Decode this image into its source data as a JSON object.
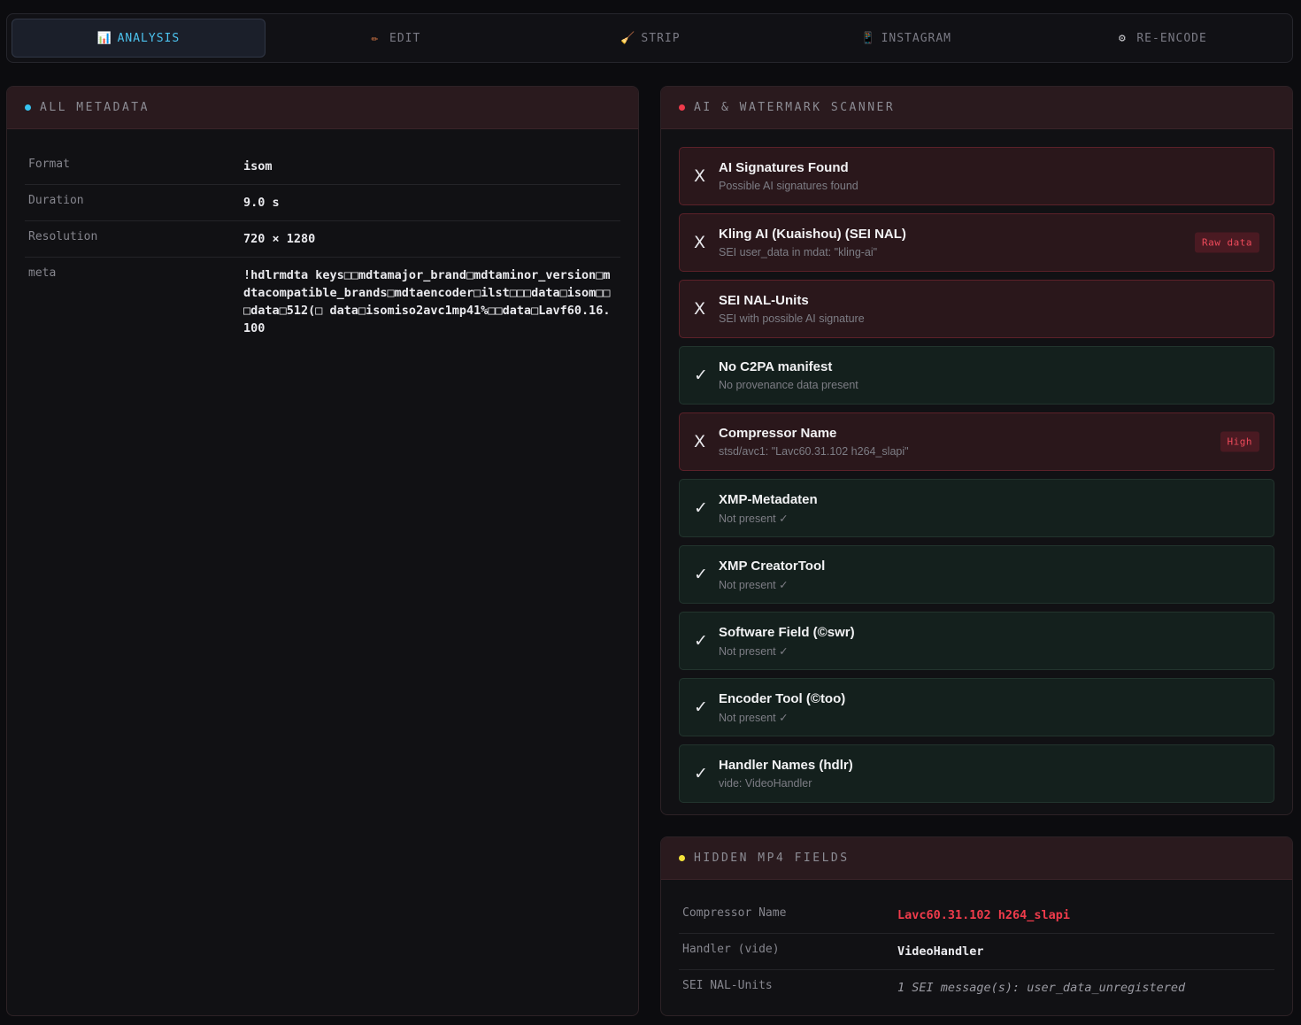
{
  "tabs": [
    {
      "icon": "📊",
      "label": "ANALYSIS",
      "active": true
    },
    {
      "icon": "✏",
      "label": "EDIT"
    },
    {
      "icon": "🧹",
      "label": "STRIP"
    },
    {
      "icon": "📱",
      "label": "INSTAGRAM"
    },
    {
      "icon": "⚙",
      "label": "RE-ENCODE"
    }
  ],
  "metadata_panel": {
    "title": "ALL METADATA",
    "dot_color": "#36c3f0",
    "rows": [
      {
        "key": "Format",
        "value": "isom"
      },
      {
        "key": "Duration",
        "value": "9.0 s"
      },
      {
        "key": "Resolution",
        "value": "720 × 1280"
      },
      {
        "key": "meta",
        "value": "!hdlrmdta keys□□mdtamajor_brand□mdtaminor_version□mdtacompatible_brands□mdtaencoder□ilst□□□data□isom□□□data□512(□ data□isomiso2avc1mp41%□□data□Lavf60.16.100"
      }
    ]
  },
  "scanner_panel": {
    "title": "AI & WATERMARK SCANNER",
    "dot_color": "#ef3b4b",
    "items": [
      {
        "status": "bad",
        "mark": "X",
        "title": "AI Signatures Found",
        "subtitle": "Possible AI signatures found",
        "badge": ""
      },
      {
        "status": "bad",
        "mark": "X",
        "title": "Kling AI (Kuaishou) (SEI NAL)",
        "subtitle": "SEI user_data in mdat: \"kling-ai\"",
        "badge": "Raw data"
      },
      {
        "status": "bad",
        "mark": "X",
        "title": "SEI NAL-Units",
        "subtitle": "SEI with possible AI signature",
        "badge": ""
      },
      {
        "status": "good",
        "mark": "✓",
        "title": "No C2PA manifest",
        "subtitle": "No provenance data present",
        "badge": ""
      },
      {
        "status": "bad",
        "mark": "X",
        "title": "Compressor Name",
        "subtitle": "stsd/avc1: \"Lavc60.31.102 h264_slapi\"",
        "badge": "High"
      },
      {
        "status": "good",
        "mark": "✓",
        "title": "XMP-Metadaten",
        "subtitle": "Not present ✓",
        "badge": ""
      },
      {
        "status": "good",
        "mark": "✓",
        "title": "XMP CreatorTool",
        "subtitle": "Not present ✓",
        "badge": ""
      },
      {
        "status": "good",
        "mark": "✓",
        "title": "Software Field (©swr)",
        "subtitle": "Not present ✓",
        "badge": ""
      },
      {
        "status": "good",
        "mark": "✓",
        "title": "Encoder Tool (©too)",
        "subtitle": "Not present ✓",
        "badge": ""
      },
      {
        "status": "good",
        "mark": "✓",
        "title": "Handler Names (hdlr)",
        "subtitle": "vide: VideoHandler",
        "badge": ""
      }
    ]
  },
  "hidden_panel": {
    "title": "HIDDEN MP4 FIELDS",
    "dot_color": "#f3e23a",
    "rows": [
      {
        "key": "Compressor Name",
        "value": "Lavc60.31.102 h264_slapi",
        "style": "red"
      },
      {
        "key": "Handler (vide)",
        "value": "VideoHandler",
        "style": ""
      },
      {
        "key": "SEI NAL-Units",
        "value": "1 SEI message(s): user_data_unregistered",
        "style": "italic"
      }
    ]
  }
}
